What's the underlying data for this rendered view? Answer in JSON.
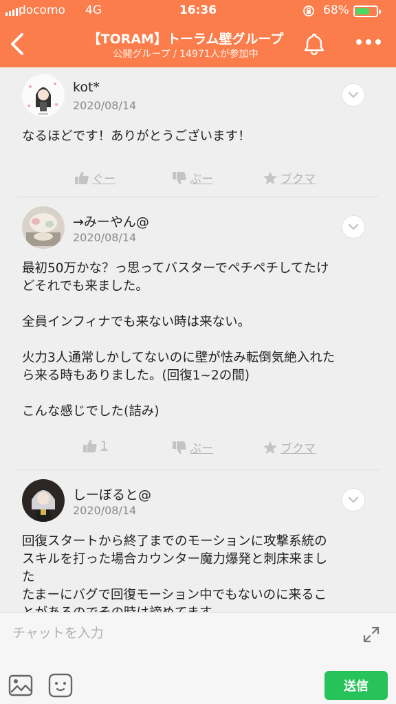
{
  "status_bar": {
    "carrier": "docomo",
    "network": "4G",
    "time": "16:36",
    "battery_percent_text": "68%",
    "battery_level": 0.68
  },
  "header": {
    "title": "【TORAM】トーラム壁グループ",
    "subtitle": "公開グループ / 14971人が参加中",
    "icons": [
      "back-icon",
      "bell-icon",
      "more-icon"
    ]
  },
  "posts": [
    {
      "username": "kot*",
      "date": "2020/08/14",
      "body": [
        "なるほどです！ありがとうございます！"
      ],
      "like_label": "ぐー",
      "dislike_label": "ぶー",
      "bookmark_label": "ブクマ"
    },
    {
      "username": "→みーやん@",
      "date": "2020/08/14",
      "body": [
        "最初50万かな？っ思ってバスターでペチペチしてたけ",
        "どそれでも来ました。",
        "全員インフィナでも来ない時は来ない。",
        "火力3人通常しかしてないのに壁が怯み転倒気絶入れた",
        "ら来る時もありました。(回復1~2の間)",
        "こんな感じでした(詰み)"
      ],
      "like_label": "1",
      "dislike_label": "ぶー",
      "bookmark_label": "ブクマ"
    },
    {
      "username": "しーぼると@",
      "date": "2020/08/14",
      "body": [
        "回復スタートから終了までのモーションに攻撃系統の",
        "スキルを打った場合カウンター魔力爆発と刺床来まし",
        "た",
        "たまーにバグで回復モーション中でもないのに来るこ",
        "とがあるのでその時は諦めてます"
      ],
      "like_label": "",
      "dislike_label": "",
      "bookmark_label": ""
    }
  ],
  "composer": {
    "placeholder": "チャットを入力",
    "send_label": "送信"
  },
  "colors": {
    "header": "#fa7d4b",
    "send": "#27c35a",
    "background": "#efefef"
  }
}
